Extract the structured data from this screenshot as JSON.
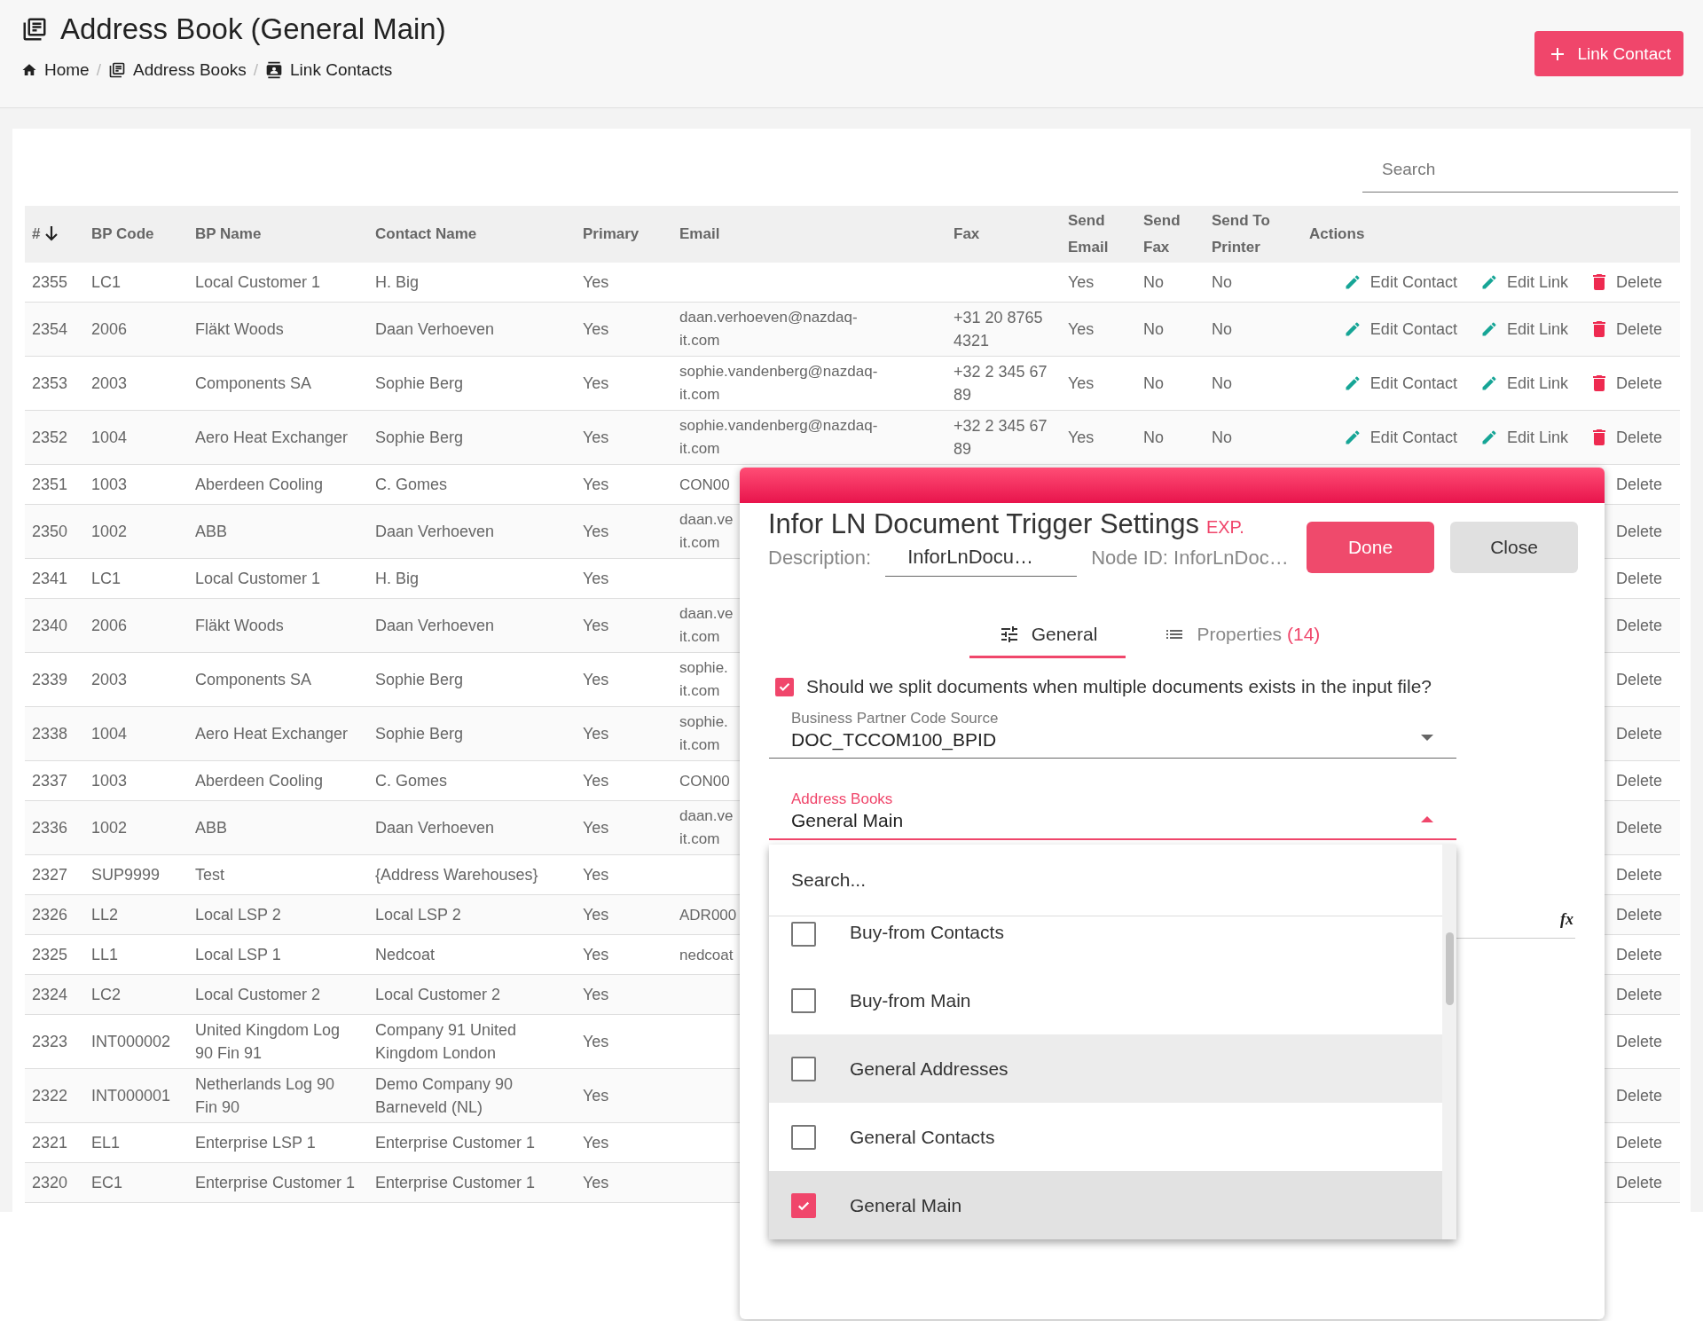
{
  "page": {
    "title": "Address Book (General Main)",
    "breadcrumbs": [
      {
        "label": "Home",
        "kind": "home"
      },
      {
        "label": "Address Books",
        "kind": "books"
      },
      {
        "label": "Link Contacts",
        "kind": "contact"
      }
    ],
    "separator": "/",
    "primary_button": "Link Contact"
  },
  "table": {
    "search": {
      "placeholder": "Search"
    },
    "columns": [
      {
        "label": "#",
        "sorted": true
      },
      {
        "label": "BP Code",
        "sorted": false
      },
      {
        "label": "BP Name",
        "sorted": false
      },
      {
        "label": "Contact Name",
        "sorted": false
      },
      {
        "label": "Primary",
        "sorted": false
      },
      {
        "label": "Email",
        "sorted": false
      },
      {
        "label": "Fax",
        "sorted": false
      },
      {
        "label": "Send Email",
        "sorted": false
      },
      {
        "label": "Send Fax",
        "sorted": false
      },
      {
        "label": "Send To Printer",
        "sorted": false
      },
      {
        "label": "Actions",
        "sorted": false
      }
    ],
    "rows": [
      {
        "id": "2355",
        "bp_code": "LC1",
        "bp_name": "Local Customer 1",
        "contact_name": "H. Big",
        "primary": "Yes",
        "send_email": "Yes",
        "send_fax": "No",
        "send_to_printer": "No",
        "actions": [
          {
            "label": "Edit Contact",
            "kind": "edit"
          },
          {
            "label": "Edit Link",
            "kind": "edit"
          },
          {
            "label": "Delete",
            "kind": "delete"
          }
        ]
      },
      {
        "id": "2354",
        "bp_code": "2006",
        "bp_name": "Fläkt Woods",
        "contact_name": "Daan Verhoeven",
        "primary": "Yes",
        "email": "daan.verhoeven@nazdaq-it.com",
        "fax": "+31 20 8765 4321",
        "send_email": "Yes",
        "send_fax": "No",
        "send_to_printer": "No",
        "actions": [
          {
            "label": "Edit Contact",
            "kind": "edit"
          },
          {
            "label": "Edit Link",
            "kind": "edit"
          },
          {
            "label": "Delete",
            "kind": "delete"
          }
        ]
      },
      {
        "id": "2353",
        "bp_code": "2003",
        "bp_name": "Components SA",
        "contact_name": "Sophie Berg",
        "primary": "Yes",
        "email": "sophie.vandenberg@nazdaq-it.com",
        "fax": "+32 2 345 67 89",
        "send_email": "Yes",
        "send_fax": "No",
        "send_to_printer": "No",
        "actions": [
          {
            "label": "Edit Contact",
            "kind": "edit"
          },
          {
            "label": "Edit Link",
            "kind": "edit"
          },
          {
            "label": "Delete",
            "kind": "delete"
          }
        ]
      },
      {
        "id": "2352",
        "bp_code": "1004",
        "bp_name": "Aero Heat Exchanger",
        "contact_name": "Sophie Berg",
        "primary": "Yes",
        "email": "sophie.vandenberg@nazdaq-it.com",
        "fax": "+32 2 345 67 89",
        "send_email": "Yes",
        "send_fax": "No",
        "send_to_printer": "No",
        "actions": [
          {
            "label": "Edit Contact",
            "kind": "edit"
          },
          {
            "label": "Edit Link",
            "kind": "edit"
          },
          {
            "label": "Delete",
            "kind": "delete"
          }
        ]
      },
      {
        "id": "2351",
        "bp_code": "1003",
        "bp_name": "Aberdeen Cooling",
        "contact_name": "C. Gomes",
        "primary": "Yes",
        "email": "CON00",
        "actions": [
          {
            "label": "Delete",
            "kind": "plain"
          }
        ]
      },
      {
        "id": "2350",
        "bp_code": "1002",
        "bp_name": "ABB",
        "contact_name": "Daan Verhoeven",
        "primary": "Yes",
        "email": "daan.ve\nit.com",
        "actions": [
          {
            "label": "Delete",
            "kind": "plain"
          }
        ]
      },
      {
        "id": "2341",
        "bp_code": "LC1",
        "bp_name": "Local Customer 1",
        "contact_name": "H. Big",
        "primary": "Yes",
        "actions": [
          {
            "label": "Delete",
            "kind": "plain"
          }
        ]
      },
      {
        "id": "2340",
        "bp_code": "2006",
        "bp_name": "Fläkt Woods",
        "contact_name": "Daan Verhoeven",
        "primary": "Yes",
        "email": "daan.ve\nit.com",
        "actions": [
          {
            "label": "Delete",
            "kind": "plain"
          }
        ]
      },
      {
        "id": "2339",
        "bp_code": "2003",
        "bp_name": "Components SA",
        "contact_name": "Sophie Berg",
        "primary": "Yes",
        "email": "sophie.\nit.com",
        "actions": [
          {
            "label": "Delete",
            "kind": "plain"
          }
        ]
      },
      {
        "id": "2338",
        "bp_code": "1004",
        "bp_name": "Aero Heat Exchanger",
        "contact_name": "Sophie Berg",
        "primary": "Yes",
        "email": "sophie.\nit.com",
        "actions": [
          {
            "label": "Delete",
            "kind": "plain"
          }
        ]
      },
      {
        "id": "2337",
        "bp_code": "1003",
        "bp_name": "Aberdeen Cooling",
        "contact_name": "C. Gomes",
        "primary": "Yes",
        "email": "CON00",
        "actions": [
          {
            "label": "Delete",
            "kind": "plain"
          }
        ]
      },
      {
        "id": "2336",
        "bp_code": "1002",
        "bp_name": "ABB",
        "contact_name": "Daan Verhoeven",
        "primary": "Yes",
        "email": "daan.ve\nit.com",
        "actions": [
          {
            "label": "Delete",
            "kind": "plain"
          }
        ]
      },
      {
        "id": "2327",
        "bp_code": "SUP9999",
        "bp_name": "Test",
        "contact_name": "{Address Warehouses}",
        "primary": "Yes",
        "actions": [
          {
            "label": "Delete",
            "kind": "plain"
          }
        ]
      },
      {
        "id": "2326",
        "bp_code": "LL2",
        "bp_name": "Local LSP 2",
        "contact_name": "Local LSP 2",
        "primary": "Yes",
        "email": "ADR000",
        "actions": [
          {
            "label": "Delete",
            "kind": "plain"
          }
        ]
      },
      {
        "id": "2325",
        "bp_code": "LL1",
        "bp_name": "Local LSP 1",
        "contact_name": "Nedcoat",
        "primary": "Yes",
        "email": "nedcoat",
        "actions": [
          {
            "label": "Delete",
            "kind": "plain"
          }
        ]
      },
      {
        "id": "2324",
        "bp_code": "LC2",
        "bp_name": "Local Customer 2",
        "contact_name": "Local Customer 2",
        "primary": "Yes",
        "actions": [
          {
            "label": "Delete",
            "kind": "plain"
          }
        ]
      },
      {
        "id": "2323",
        "bp_code": "INT000002",
        "bp_name": "United Kingdom Log 90 Fin 91",
        "contact_name": "Company 91 United Kingdom London",
        "primary": "Yes",
        "actions": [
          {
            "label": "Delete",
            "kind": "plain"
          }
        ]
      },
      {
        "id": "2322",
        "bp_code": "INT000001",
        "bp_name": "Netherlands Log 90 Fin 90",
        "contact_name": "Demo Company 90 Barneveld (NL)",
        "primary": "Yes",
        "actions": [
          {
            "label": "Delete",
            "kind": "plain"
          }
        ]
      },
      {
        "id": "2321",
        "bp_code": "EL1",
        "bp_name": "Enterprise LSP 1",
        "contact_name": "Enterprise Customer 1",
        "primary": "Yes",
        "actions": [
          {
            "label": "Delete",
            "kind": "plain"
          }
        ]
      },
      {
        "id": "2320",
        "bp_code": "EC1",
        "bp_name": "Enterprise Customer 1",
        "contact_name": "Enterprise Customer 1",
        "primary": "Yes",
        "actions": [
          {
            "label": "Delete",
            "kind": "plain"
          }
        ]
      }
    ]
  },
  "dialog": {
    "title": "Infor LN Document Trigger Settings",
    "badge": "EXP.",
    "description_label": "Description:",
    "description_value": "InforLnDocu…",
    "node_id": "Node ID: InforLnDoc…",
    "buttons": [
      {
        "label": "Done",
        "kind": "primary"
      },
      {
        "label": "Close",
        "kind": "secondary"
      }
    ],
    "tabs": [
      {
        "label": "General",
        "kind": "general",
        "selected": true
      },
      {
        "label": "Properties",
        "count": "(14)",
        "kind": "properties",
        "selected": false
      }
    ],
    "split_checkbox": {
      "label": "Should we split documents when multiple documents exists in the input file?",
      "checked": true
    },
    "bp_code_source": {
      "label": "Business Partner Code Source",
      "value": "DOC_TCCOM100_BPID",
      "expanded": false
    },
    "address_books": {
      "label": "Address Books",
      "value": "General Main",
      "expanded": true
    },
    "formula_button": "fx",
    "dropdown": {
      "search_placeholder": "Search...",
      "options": [
        {
          "label": "Buy-from Contacts",
          "checked": false,
          "hovered": false
        },
        {
          "label": "Buy-from Main",
          "checked": false,
          "hovered": false
        },
        {
          "label": "General Addresses",
          "checked": false,
          "hovered": true
        },
        {
          "label": "General Contacts",
          "checked": false,
          "hovered": false
        },
        {
          "label": "General Main",
          "checked": true,
          "hovered": false
        }
      ]
    }
  }
}
